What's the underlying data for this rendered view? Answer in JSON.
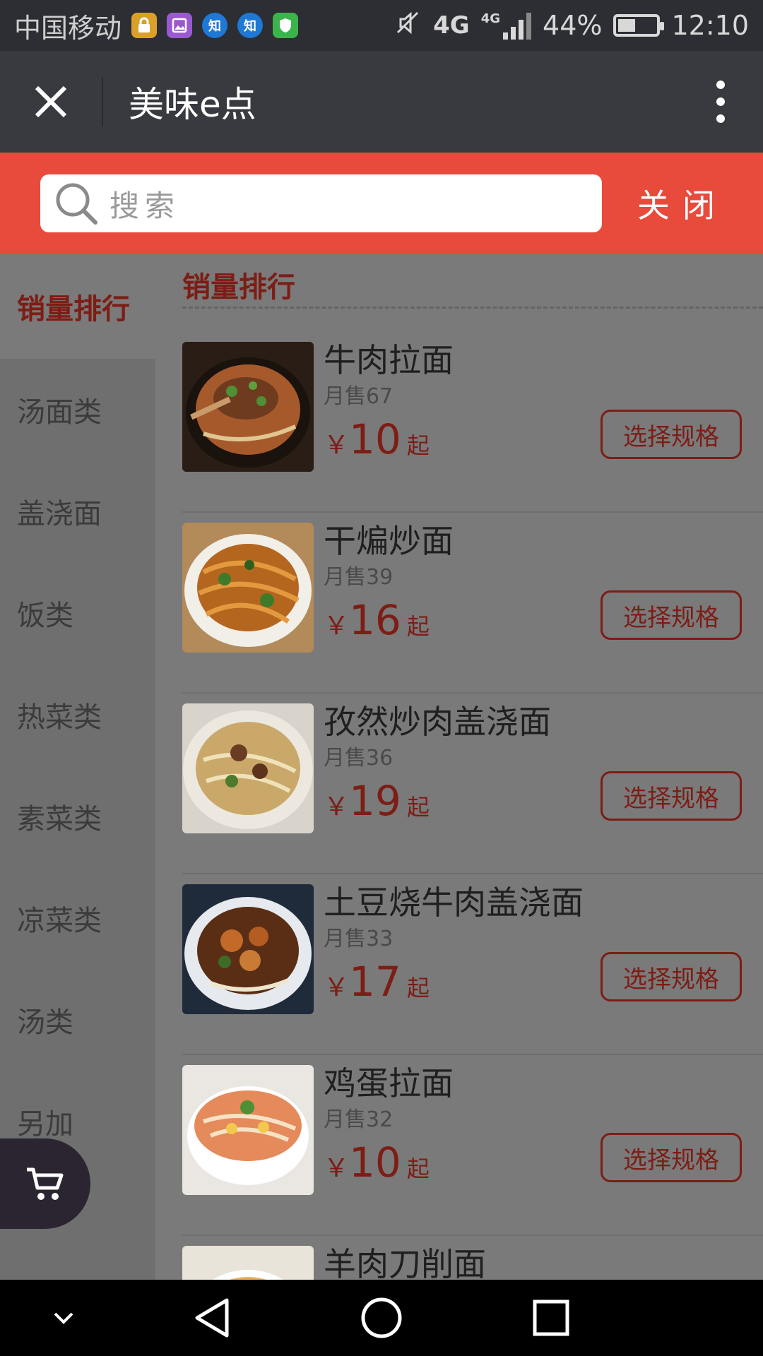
{
  "status_bar": {
    "carrier": "中国移动",
    "apps": [
      {
        "icon": "lock-app-icon",
        "color": "#d9a02b",
        "glyph": "🔒"
      },
      {
        "icon": "gallery-app-icon",
        "color": "#9b59d0",
        "glyph": "▣"
      },
      {
        "icon": "zhihu-app-icon",
        "color": "#1e78d6",
        "glyph": "知"
      },
      {
        "icon": "zhihu-app-icon",
        "color": "#1e78d6",
        "glyph": "知"
      },
      {
        "icon": "shield-app-icon",
        "color": "#3cb44b",
        "glyph": "⛨"
      }
    ],
    "network": "4G",
    "network_small": "4G",
    "battery": "44%",
    "time": "12:10"
  },
  "title_bar": {
    "title": "美味e点"
  },
  "search": {
    "placeholder": "搜索",
    "close_label": "关闭"
  },
  "sidebar": {
    "items": [
      {
        "label": "销量排行",
        "active": true
      },
      {
        "label": "汤面类"
      },
      {
        "label": "盖浇面"
      },
      {
        "label": "饭类"
      },
      {
        "label": "热菜类"
      },
      {
        "label": "素菜类"
      },
      {
        "label": "凉菜类"
      },
      {
        "label": "汤类"
      },
      {
        "label": "另加"
      }
    ]
  },
  "content": {
    "section_title": "销量排行",
    "spec_label": "选择规格",
    "price_suffix": "起",
    "currency": "￥",
    "items": [
      {
        "name": "牛肉拉面",
        "sales": "月售67",
        "price": "10"
      },
      {
        "name": "干煸炒面",
        "sales": "月售39",
        "price": "16"
      },
      {
        "name": "孜然炒肉盖浇面",
        "sales": "月售36",
        "price": "19"
      },
      {
        "name": "土豆烧牛肉盖浇面",
        "sales": "月售33",
        "price": "17"
      },
      {
        "name": "鸡蛋拉面",
        "sales": "月售32",
        "price": "10"
      },
      {
        "name": "羊肉刀削面",
        "sales": "",
        "price": ""
      }
    ]
  },
  "colors": {
    "accent": "#e84a3c",
    "price": "#7c1d16",
    "title_bar": "#393a3f"
  }
}
